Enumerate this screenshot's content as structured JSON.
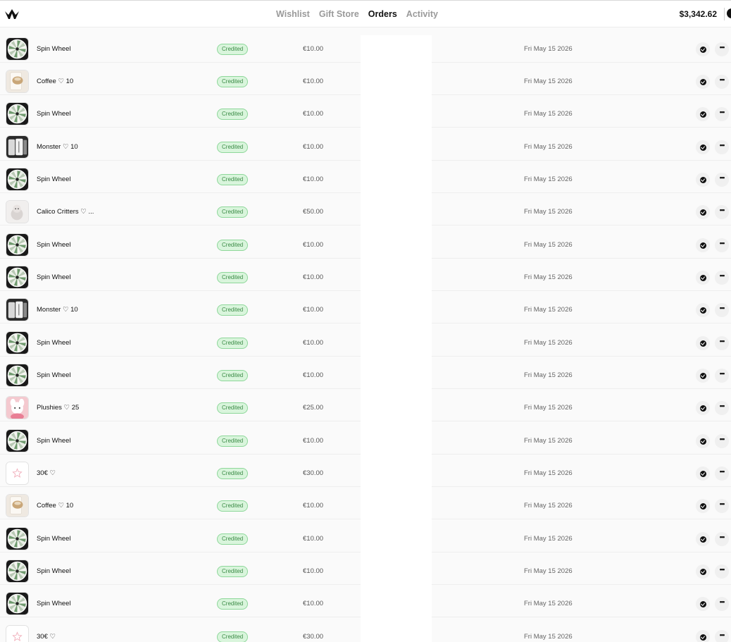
{
  "header": {
    "logo_icon": "crown-leaf-logo-icon",
    "nav": [
      {
        "label": "Wishlist",
        "active": false
      },
      {
        "label": "Gift Store",
        "active": false
      },
      {
        "label": "Orders",
        "active": true
      },
      {
        "label": "Activity",
        "active": false
      }
    ],
    "balance": "$3,342.62"
  },
  "colors": {
    "badge_bg": "#d9f5dc",
    "badge_border": "#8ed79a",
    "badge_text": "#3a8a45"
  },
  "orders": [
    {
      "name": "Spin Wheel",
      "thumb": "wheel",
      "status": "Credited",
      "amount": "€10.00",
      "date": "Fri May 15 2026"
    },
    {
      "name": "Coffee ♡ 10",
      "thumb": "coffee",
      "status": "Credited",
      "amount": "€10.00",
      "date": "Fri May 15 2026"
    },
    {
      "name": "Spin Wheel",
      "thumb": "wheel",
      "status": "Credited",
      "amount": "€10.00",
      "date": "Fri May 15 2026"
    },
    {
      "name": "Monster ♡ 10",
      "thumb": "monster",
      "status": "Credited",
      "amount": "€10.00",
      "date": "Fri May 15 2026"
    },
    {
      "name": "Spin Wheel",
      "thumb": "wheel",
      "status": "Credited",
      "amount": "€10.00",
      "date": "Fri May 15 2026"
    },
    {
      "name": "Calico Critters ♡ ...",
      "thumb": "critters",
      "status": "Credited",
      "amount": "€50.00",
      "date": "Fri May 15 2026"
    },
    {
      "name": "Spin Wheel",
      "thumb": "wheel",
      "status": "Credited",
      "amount": "€10.00",
      "date": "Fri May 15 2026"
    },
    {
      "name": "Spin Wheel",
      "thumb": "wheel",
      "status": "Credited",
      "amount": "€10.00",
      "date": "Fri May 15 2026"
    },
    {
      "name": "Monster ♡ 10",
      "thumb": "monster",
      "status": "Credited",
      "amount": "€10.00",
      "date": "Fri May 15 2026"
    },
    {
      "name": "Spin Wheel",
      "thumb": "wheel",
      "status": "Credited",
      "amount": "€10.00",
      "date": "Fri May 15 2026"
    },
    {
      "name": "Spin Wheel",
      "thumb": "wheel",
      "status": "Credited",
      "amount": "€10.00",
      "date": "Fri May 15 2026"
    },
    {
      "name": "Plushies ♡ 25",
      "thumb": "plush",
      "status": "Credited",
      "amount": "€25.00",
      "date": "Fri May 15 2026"
    },
    {
      "name": "Spin Wheel",
      "thumb": "wheel",
      "status": "Credited",
      "amount": "€10.00",
      "date": "Fri May 15 2026"
    },
    {
      "name": "30€ ♡",
      "thumb": "star",
      "status": "Credited",
      "amount": "€30.00",
      "date": "Fri May 15 2026"
    },
    {
      "name": "Coffee ♡ 10",
      "thumb": "coffee",
      "status": "Credited",
      "amount": "€10.00",
      "date": "Fri May 15 2026"
    },
    {
      "name": "Spin Wheel",
      "thumb": "wheel",
      "status": "Credited",
      "amount": "€10.00",
      "date": "Fri May 15 2026"
    },
    {
      "name": "Spin Wheel",
      "thumb": "wheel",
      "status": "Credited",
      "amount": "€10.00",
      "date": "Fri May 15 2026"
    },
    {
      "name": "Spin Wheel",
      "thumb": "wheel",
      "status": "Credited",
      "amount": "€10.00",
      "date": "Fri May 15 2026"
    },
    {
      "name": "30€ ♡",
      "thumb": "star",
      "status": "Credited",
      "amount": "€30.00",
      "date": "Fri May 15 2026"
    }
  ]
}
